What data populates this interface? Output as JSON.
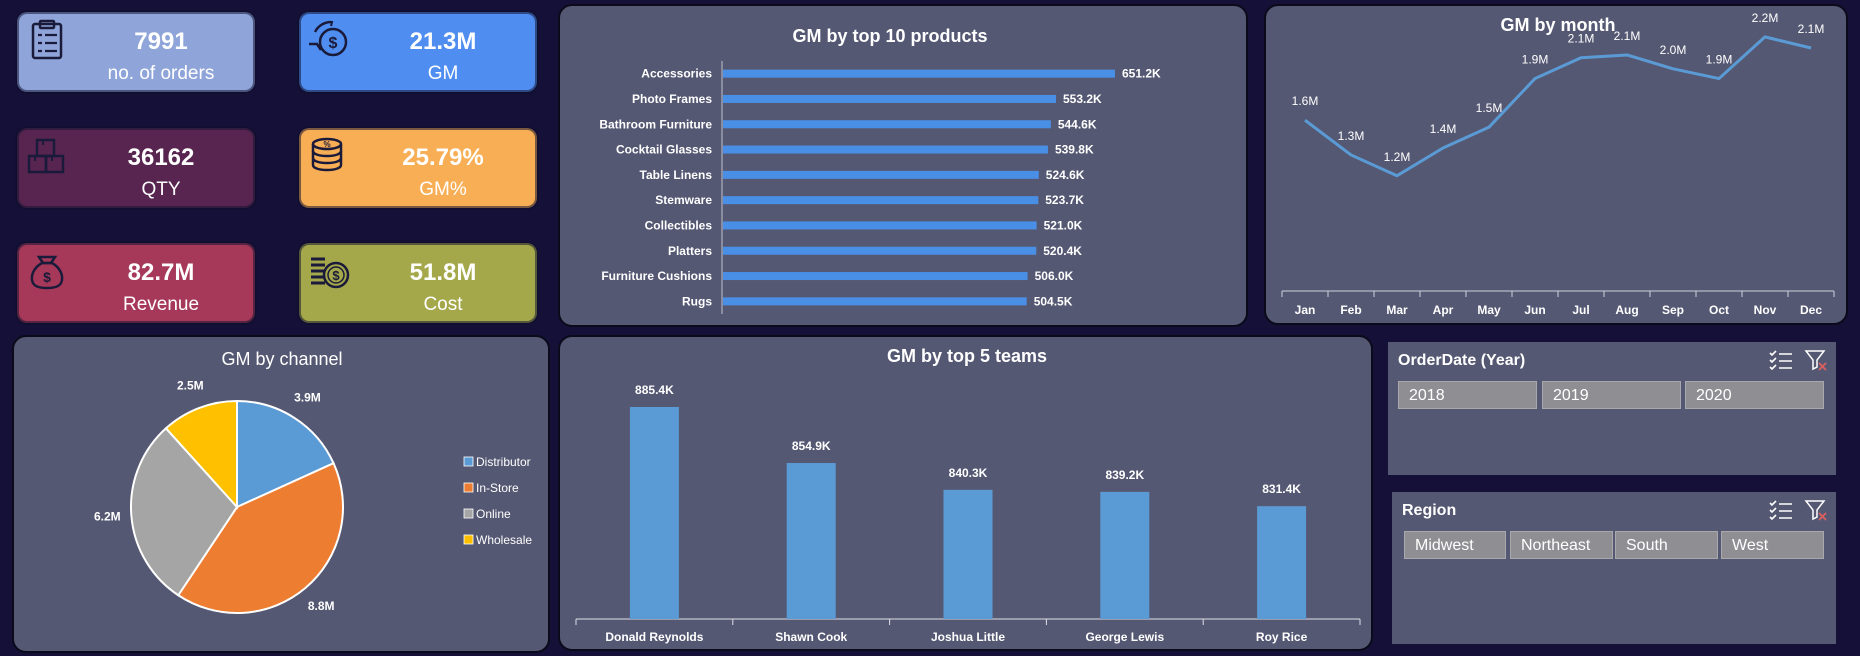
{
  "kpis": [
    {
      "value": "7991",
      "label": "no. of orders",
      "icon": "clipboard-icon",
      "color": "#8fa5d9"
    },
    {
      "value": "21.3M",
      "label": "GM",
      "icon": "dollar-cycle-icon",
      "color": "#4f8ef0"
    },
    {
      "value": "36162",
      "label": "QTY",
      "icon": "boxes-icon",
      "color": "#572550"
    },
    {
      "value": "25.79%",
      "label": "GM%",
      "icon": "coins-percent-icon",
      "color": "#f7ae55"
    },
    {
      "value": "82.7M",
      "label": "Revenue",
      "icon": "money-bag-icon",
      "color": "#a6395a"
    },
    {
      "value": "51.8M",
      "label": "Cost",
      "icon": "coins-dollar-icon",
      "color": "#a4a84a"
    }
  ],
  "chart_data": [
    {
      "type": "bar",
      "orientation": "horizontal",
      "title": "GM by top 10 products",
      "categories": [
        "Accessories",
        "Photo Frames",
        "Bathroom Furniture",
        "Cocktail Glasses",
        "Table Linens",
        "Stemware",
        "Collectibles",
        "Platters",
        "Furniture Cushions",
        "Rugs"
      ],
      "values": [
        651.2,
        553.2,
        544.6,
        539.8,
        524.6,
        523.7,
        521.0,
        520.4,
        506.0,
        504.5
      ],
      "labels": [
        "651.2K",
        "553.2K",
        "544.6K",
        "539.8K",
        "524.6K",
        "523.7K",
        "521.0K",
        "520.4K",
        "506.0K",
        "504.5K"
      ],
      "color": "#4a8fe6"
    },
    {
      "type": "line",
      "title": "GM by month",
      "categories": [
        "Jan",
        "Feb",
        "Mar",
        "Apr",
        "May",
        "Jun",
        "Jul",
        "Aug",
        "Sep",
        "Oct",
        "Nov",
        "Dec"
      ],
      "values": [
        1.6,
        1.35,
        1.2,
        1.4,
        1.55,
        1.9,
        2.05,
        2.07,
        1.97,
        1.9,
        2.2,
        2.12
      ],
      "labels": [
        "1.6M",
        "1.3M",
        "1.2M",
        "1.4M",
        "1.5M",
        "1.9M",
        "2.1M",
        "2.1M",
        "2.0M",
        "1.9M",
        "2.2M",
        "2.1M"
      ],
      "color": "#5b9bd5"
    },
    {
      "type": "pie",
      "title": "GM by channel",
      "categories": [
        "Distributor",
        "In-Store",
        "Online",
        "Wholesale"
      ],
      "values": [
        3.9,
        8.8,
        6.2,
        2.5
      ],
      "labels": [
        "3.9M",
        "8.8M",
        "6.2M",
        "2.5M"
      ],
      "colors": [
        "#5b9bd5",
        "#ed7d31",
        "#a5a5a5",
        "#ffc000"
      ],
      "legend": "right"
    },
    {
      "type": "bar",
      "orientation": "vertical",
      "title": "GM by top 5 teams",
      "categories": [
        "Donald Reynolds",
        "Shawn Cook",
        "Joshua Little",
        "George Lewis",
        "Roy Rice"
      ],
      "values": [
        885.4,
        854.9,
        840.3,
        839.2,
        831.4
      ],
      "labels": [
        "885.4K",
        "854.9K",
        "840.3K",
        "839.2K",
        "831.4K"
      ],
      "color": "#5b9bd5"
    }
  ],
  "slicers": {
    "year": {
      "title": "OrderDate (Year)",
      "items": [
        "2018",
        "2019",
        "2020"
      ]
    },
    "region": {
      "title": "Region",
      "items": [
        "Midwest",
        "Northeast",
        "South",
        "West"
      ]
    }
  }
}
